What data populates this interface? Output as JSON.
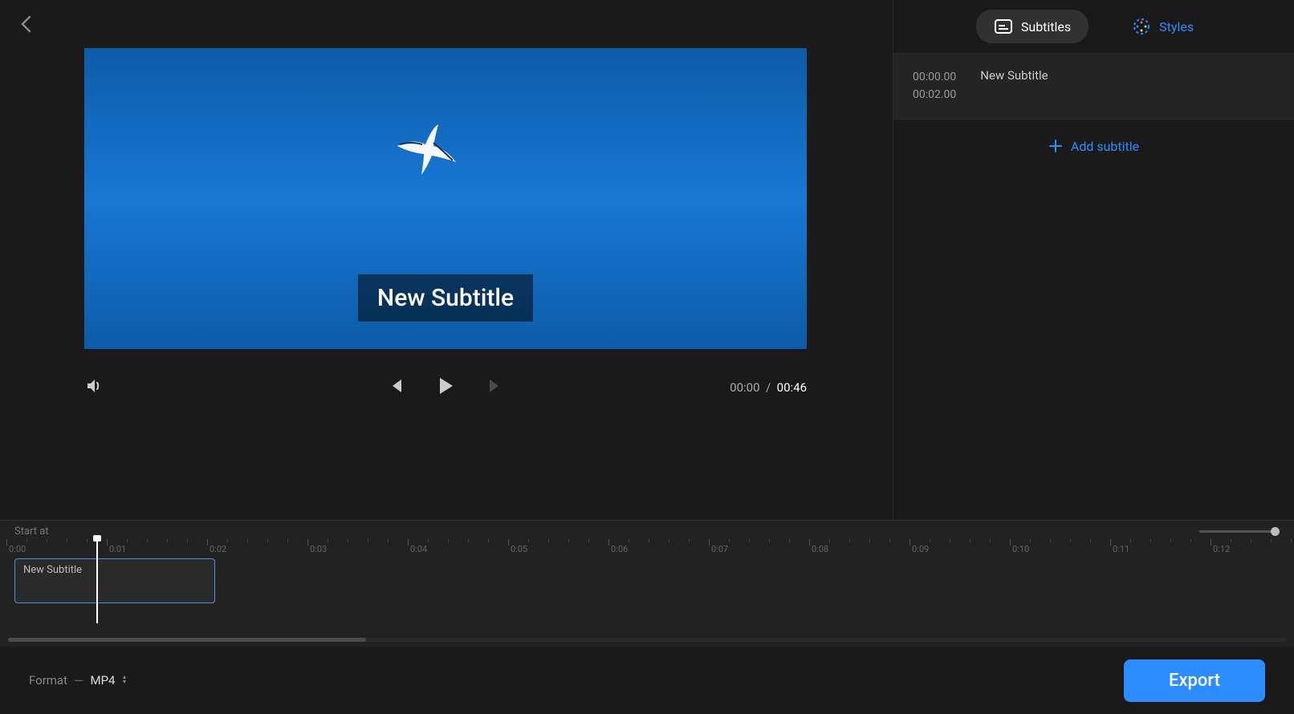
{
  "tabs": {
    "subtitles_label": "Subtitles",
    "styles_label": "Styles"
  },
  "subtitle_list": [
    {
      "start": "00:00.00",
      "end": "00:02.00",
      "text": "New Subtitle"
    }
  ],
  "add_subtitle_label": "Add subtitle",
  "preview": {
    "subtitle_text": "New Subtitle"
  },
  "playback": {
    "current_time": "00:00",
    "total_time": "00:46",
    "separator": "/"
  },
  "timeline": {
    "start_label": "Start at",
    "ruler_ticks": [
      "0:00",
      "0:01",
      "0:02",
      "0:03",
      "0:04",
      "0:05",
      "0:06",
      "0:07",
      "0:08",
      "0:09",
      "0:10",
      "0:11",
      "0:12"
    ],
    "clip_text": "New Subtitle"
  },
  "bottom": {
    "format_label": "Format",
    "format_value": "MP4",
    "export_label": "Export"
  }
}
